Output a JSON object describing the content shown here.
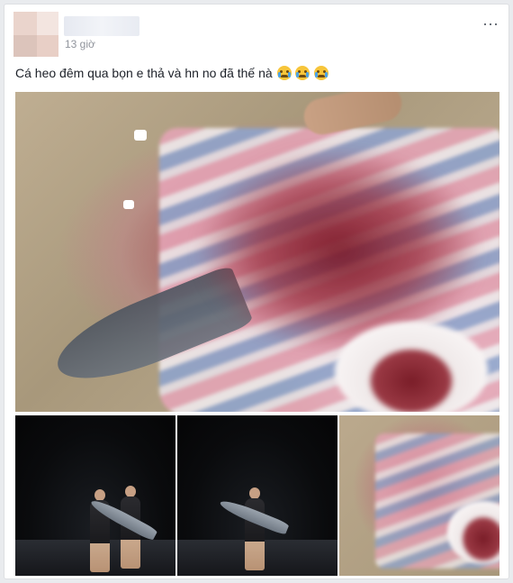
{
  "post": {
    "timestamp": "13 giờ",
    "text": "Cá heo đêm qua bọn e thả và hn no đã thế nà",
    "emojis": [
      "crying-emoji",
      "crying-emoji",
      "crying-emoji"
    ],
    "more_icon": "⋯"
  },
  "colors": {
    "page_bg": "#e9ebee",
    "card_bg": "#ffffff",
    "text": "#1d2129",
    "meta": "#90949c"
  }
}
